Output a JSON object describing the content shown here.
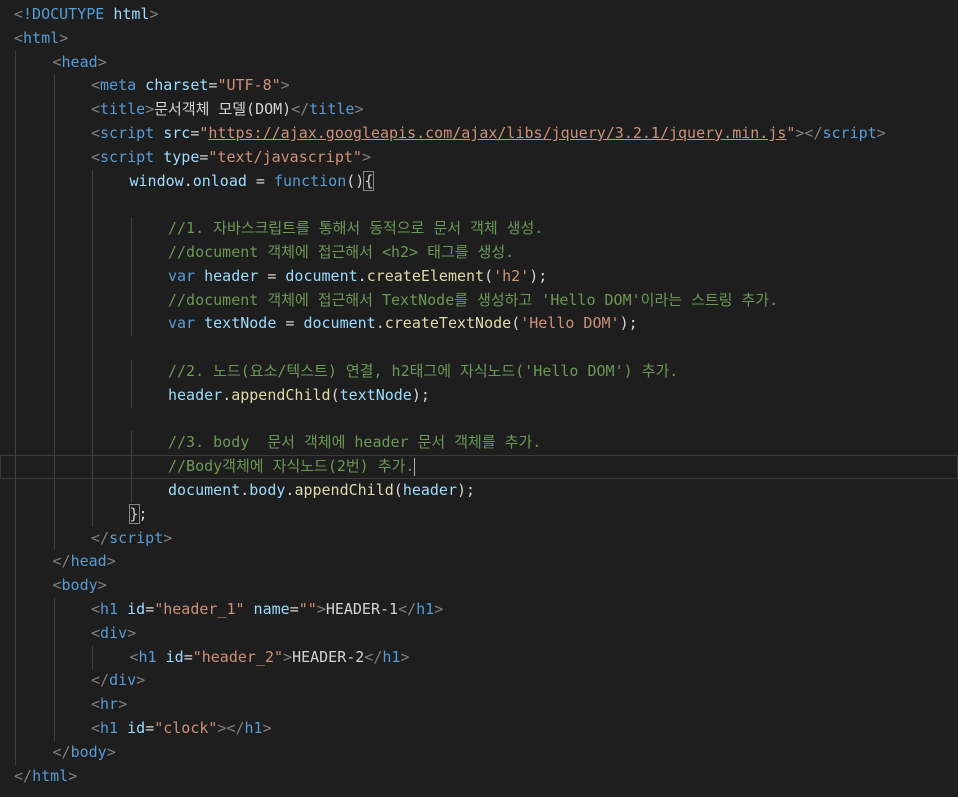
{
  "editor": {
    "lines": [
      {
        "indent": 0,
        "tokens": [
          [
            "k-punct",
            "<"
          ],
          [
            "k-tag",
            "!DOCUTYPE"
          ],
          [
            "k-attr",
            " html"
          ],
          [
            "k-punct",
            ">"
          ]
        ]
      },
      {
        "indent": 0,
        "tokens": [
          [
            "k-punct",
            "<"
          ],
          [
            "k-tag",
            "html"
          ],
          [
            "k-punct",
            ">"
          ]
        ]
      },
      {
        "indent": 1,
        "tokens": [
          [
            "k-punct",
            "<"
          ],
          [
            "k-tag",
            "head"
          ],
          [
            "k-punct",
            ">"
          ]
        ]
      },
      {
        "indent": 2,
        "tokens": [
          [
            "k-punct",
            "<"
          ],
          [
            "k-tag",
            "meta"
          ],
          [
            "k-attr",
            " charset"
          ],
          [
            "k-text",
            "="
          ],
          [
            "k-str",
            "\"UTF-8\""
          ],
          [
            "k-punct",
            ">"
          ]
        ]
      },
      {
        "indent": 2,
        "tokens": [
          [
            "k-punct",
            "<"
          ],
          [
            "k-tag",
            "title"
          ],
          [
            "k-punct",
            ">"
          ],
          [
            "k-text",
            "문서객체 모델(DOM)"
          ],
          [
            "k-punct",
            "</"
          ],
          [
            "k-tag",
            "title"
          ],
          [
            "k-punct",
            ">"
          ]
        ]
      },
      {
        "indent": 2,
        "tokens": [
          [
            "k-punct",
            "<"
          ],
          [
            "k-tag",
            "script"
          ],
          [
            "k-attr",
            " src"
          ],
          [
            "k-text",
            "="
          ],
          [
            "k-str",
            "\""
          ],
          [
            "k-url",
            "https://ajax.googleapis.com/ajax/libs/jquery/3.2.1/jquery.min.js"
          ],
          [
            "k-str",
            "\""
          ],
          [
            "k-punct",
            "></"
          ],
          [
            "k-tag",
            "script"
          ],
          [
            "k-punct",
            ">"
          ]
        ]
      },
      {
        "indent": 2,
        "tokens": [
          [
            "k-punct",
            "<"
          ],
          [
            "k-tag",
            "script"
          ],
          [
            "k-attr",
            " type"
          ],
          [
            "k-text",
            "="
          ],
          [
            "k-str",
            "\"text/javascript\""
          ],
          [
            "k-punct",
            ">"
          ]
        ]
      },
      {
        "indent": 3,
        "tokens": [
          [
            "k-var",
            "window"
          ],
          [
            "k-text",
            "."
          ],
          [
            "k-var",
            "onload"
          ],
          [
            "k-text",
            " = "
          ],
          [
            "k-kw",
            "function"
          ],
          [
            "k-text",
            "()"
          ],
          [
            "k-bracket-hl",
            "{"
          ]
        ]
      },
      {
        "indent": 3,
        "tokens": []
      },
      {
        "indent": 4,
        "tokens": [
          [
            "k-comment",
            "//1. 자바스크립트를 통해서 동적으로 문서 객체 생성."
          ]
        ]
      },
      {
        "indent": 4,
        "tokens": [
          [
            "k-comment",
            "//document 객체에 접근해서 <h2> 태그를 생성."
          ]
        ]
      },
      {
        "indent": 4,
        "tokens": [
          [
            "k-kw",
            "var"
          ],
          [
            "k-var",
            " header"
          ],
          [
            "k-text",
            " = "
          ],
          [
            "k-var",
            "document"
          ],
          [
            "k-text",
            "."
          ],
          [
            "k-fn",
            "createElement"
          ],
          [
            "k-text",
            "("
          ],
          [
            "k-str",
            "'h2'"
          ],
          [
            "k-text",
            ");"
          ]
        ]
      },
      {
        "indent": 4,
        "tokens": [
          [
            "k-comment",
            "//document 객체에 접근해서 TextNode를 생성하고 'Hello DOM'이라는 스트링 추가."
          ]
        ]
      },
      {
        "indent": 4,
        "tokens": [
          [
            "k-kw",
            "var"
          ],
          [
            "k-var",
            " textNode"
          ],
          [
            "k-text",
            " = "
          ],
          [
            "k-var",
            "document"
          ],
          [
            "k-text",
            "."
          ],
          [
            "k-fn",
            "createTextNode"
          ],
          [
            "k-text",
            "("
          ],
          [
            "k-str",
            "'Hello DOM'"
          ],
          [
            "k-text",
            ");"
          ]
        ]
      },
      {
        "indent": 3,
        "tokens": []
      },
      {
        "indent": 4,
        "tokens": [
          [
            "k-comment",
            "//2. 노드(요소/텍스트) 연결, h2태그에 자식노드('Hello DOM') 추가."
          ]
        ]
      },
      {
        "indent": 4,
        "tokens": [
          [
            "k-var",
            "header"
          ],
          [
            "k-text",
            "."
          ],
          [
            "k-fn",
            "appendChild"
          ],
          [
            "k-text",
            "("
          ],
          [
            "k-var",
            "textNode"
          ],
          [
            "k-text",
            ");"
          ]
        ]
      },
      {
        "indent": 3,
        "tokens": []
      },
      {
        "indent": 4,
        "tokens": [
          [
            "k-comment",
            "//3. body  문서 객체에 header 문서 객체를 추가."
          ]
        ]
      },
      {
        "indent": 4,
        "current": true,
        "cursor": true,
        "tokens": [
          [
            "k-comment",
            "//Body객체에 자식노드(2번) 추가."
          ]
        ]
      },
      {
        "indent": 4,
        "tokens": [
          [
            "k-var",
            "document"
          ],
          [
            "k-text",
            "."
          ],
          [
            "k-var",
            "body"
          ],
          [
            "k-text",
            "."
          ],
          [
            "k-fn",
            "appendChild"
          ],
          [
            "k-text",
            "("
          ],
          [
            "k-var",
            "header"
          ],
          [
            "k-text",
            ");"
          ]
        ]
      },
      {
        "indent": 3,
        "tokens": [
          [
            "k-bracket-hl",
            "}"
          ],
          [
            "k-text",
            ";"
          ]
        ]
      },
      {
        "indent": 2,
        "tokens": [
          [
            "k-punct",
            "</"
          ],
          [
            "k-tag",
            "script"
          ],
          [
            "k-punct",
            ">"
          ]
        ]
      },
      {
        "indent": 1,
        "tokens": [
          [
            "k-punct",
            "</"
          ],
          [
            "k-tag",
            "head"
          ],
          [
            "k-punct",
            ">"
          ]
        ]
      },
      {
        "indent": 1,
        "tokens": [
          [
            "k-punct",
            "<"
          ],
          [
            "k-tag",
            "body"
          ],
          [
            "k-punct",
            ">"
          ]
        ]
      },
      {
        "indent": 2,
        "tokens": [
          [
            "k-punct",
            "<"
          ],
          [
            "k-tag",
            "h1"
          ],
          [
            "k-attr",
            " id"
          ],
          [
            "k-text",
            "="
          ],
          [
            "k-str",
            "\"header_1\""
          ],
          [
            "k-attr",
            " name"
          ],
          [
            "k-text",
            "="
          ],
          [
            "k-str",
            "\"\""
          ],
          [
            "k-punct",
            ">"
          ],
          [
            "k-text",
            "HEADER-1"
          ],
          [
            "k-punct",
            "</"
          ],
          [
            "k-tag",
            "h1"
          ],
          [
            "k-punct",
            ">"
          ]
        ]
      },
      {
        "indent": 2,
        "tokens": [
          [
            "k-punct",
            "<"
          ],
          [
            "k-tag",
            "div"
          ],
          [
            "k-punct",
            ">"
          ]
        ]
      },
      {
        "indent": 3,
        "tokens": [
          [
            "k-punct",
            "<"
          ],
          [
            "k-tag",
            "h1"
          ],
          [
            "k-attr",
            " id"
          ],
          [
            "k-text",
            "="
          ],
          [
            "k-str",
            "\"header_2\""
          ],
          [
            "k-punct",
            ">"
          ],
          [
            "k-text",
            "HEADER-2"
          ],
          [
            "k-punct",
            "</"
          ],
          [
            "k-tag",
            "h1"
          ],
          [
            "k-punct",
            ">"
          ]
        ]
      },
      {
        "indent": 2,
        "tokens": [
          [
            "k-punct",
            "</"
          ],
          [
            "k-tag",
            "div"
          ],
          [
            "k-punct",
            ">"
          ]
        ]
      },
      {
        "indent": 2,
        "tokens": [
          [
            "k-punct",
            "<"
          ],
          [
            "k-tag",
            "hr"
          ],
          [
            "k-punct",
            ">"
          ]
        ]
      },
      {
        "indent": 2,
        "tokens": [
          [
            "k-punct",
            "<"
          ],
          [
            "k-tag",
            "h1"
          ],
          [
            "k-attr",
            " id"
          ],
          [
            "k-text",
            "="
          ],
          [
            "k-str",
            "\"clock\""
          ],
          [
            "k-punct",
            "></"
          ],
          [
            "k-tag",
            "h1"
          ],
          [
            "k-punct",
            ">"
          ]
        ]
      },
      {
        "indent": 1,
        "tokens": [
          [
            "k-punct",
            "</"
          ],
          [
            "k-tag",
            "body"
          ],
          [
            "k-punct",
            ">"
          ]
        ]
      },
      {
        "indent": 0,
        "tokens": [
          [
            "k-punct",
            "</"
          ],
          [
            "k-tag",
            "html"
          ],
          [
            "k-punct",
            ">"
          ]
        ]
      }
    ]
  },
  "colors": {
    "background": "#1e1e1e",
    "tag": "#569cd6",
    "attribute": "#9cdcfe",
    "string": "#ce9178",
    "comment": "#6a9955",
    "function": "#dcdcaa",
    "punctuation": "#808080",
    "text": "#d4d4d4"
  }
}
